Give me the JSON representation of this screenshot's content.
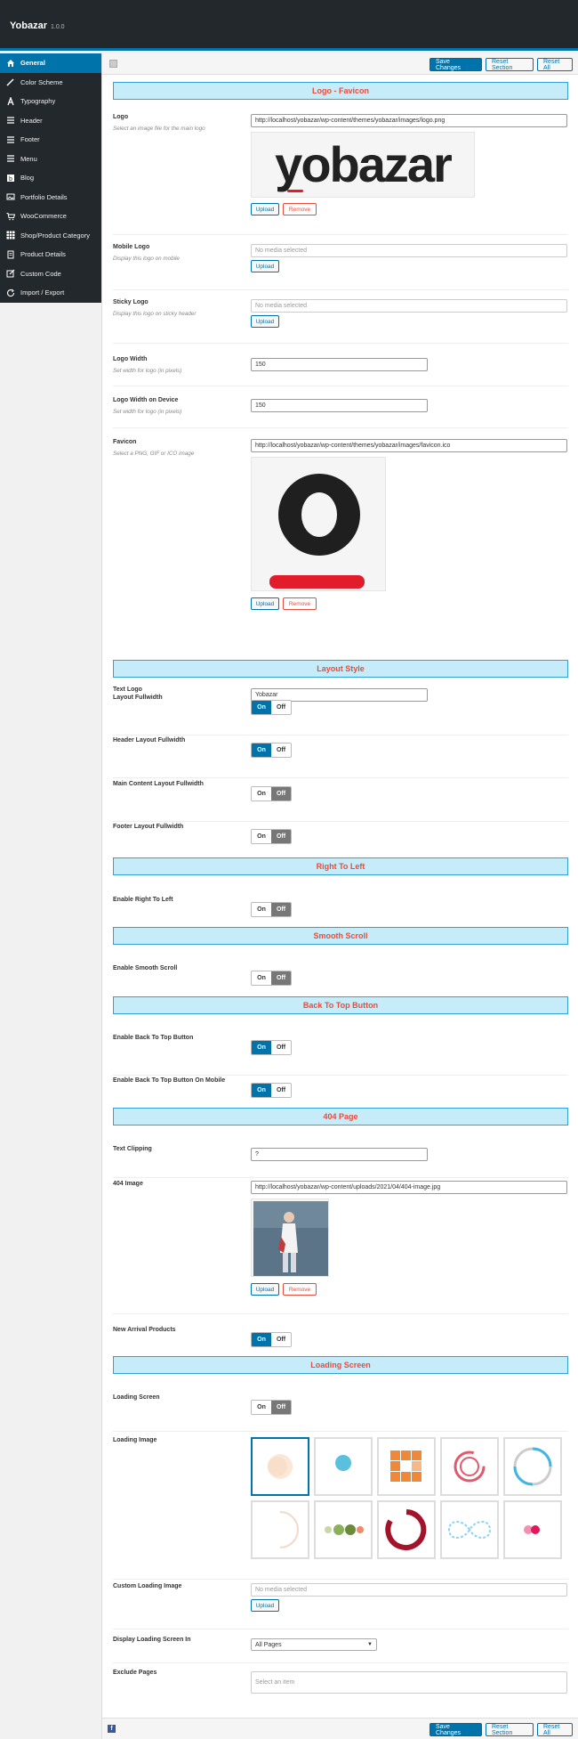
{
  "app": {
    "title": "Yobazar",
    "version": "1.0.0"
  },
  "sidebar": {
    "items": [
      {
        "label": "General",
        "icon": "home-icon",
        "active": true
      },
      {
        "label": "Color Scheme",
        "icon": "brush-icon"
      },
      {
        "label": "Typography",
        "icon": "typography-icon"
      },
      {
        "label": "Header",
        "icon": "menu-lines-icon"
      },
      {
        "label": "Footer",
        "icon": "menu-lines-icon"
      },
      {
        "label": "Menu",
        "icon": "menu-lines-icon"
      },
      {
        "label": "Blog",
        "icon": "blog-icon"
      },
      {
        "label": "Portfolio Details",
        "icon": "image-icon"
      },
      {
        "label": "WooCommerce",
        "icon": "cart-icon"
      },
      {
        "label": "Shop/Product Category",
        "icon": "grid-icon"
      },
      {
        "label": "Product Details",
        "icon": "document-icon"
      },
      {
        "label": "Custom Code",
        "icon": "edit-icon"
      },
      {
        "label": "Import / Export",
        "icon": "refresh-icon"
      }
    ]
  },
  "toolbar": {
    "save": "Save Changes",
    "reset_section": "Reset Section",
    "reset_all": "Reset All"
  },
  "sections": {
    "logo_favicon": "Logo - Favicon",
    "layout_style": "Layout Style",
    "rtl": "Right To Left",
    "smooth_scroll": "Smooth Scroll",
    "back_to_top": "Back To Top Button",
    "page_404": "404 Page",
    "loading_screen": "Loading Screen"
  },
  "buttons": {
    "upload": "Upload",
    "remove": "Remove"
  },
  "toggle": {
    "on": "On",
    "off": "Off"
  },
  "fields": {
    "logo": {
      "label": "Logo",
      "desc": "Select an image file for the main logo",
      "value": "http://localhost/yobazar/wp-content/themes/yobazar/images/logo.png",
      "preview_text": "yobazar"
    },
    "mobile_logo": {
      "label": "Mobile Logo",
      "desc": "Display this logo on mobile",
      "placeholder": "No media selected"
    },
    "sticky_logo": {
      "label": "Sticky Logo",
      "desc": "Display this logo on sticky header",
      "placeholder": "No media selected"
    },
    "logo_width": {
      "label": "Logo Width",
      "desc": "Set width for logo (in pixels)",
      "value": "150"
    },
    "logo_width_device": {
      "label": "Logo Width on Device",
      "desc": "Set width for logo (in pixels)",
      "value": "150"
    },
    "favicon": {
      "label": "Favicon",
      "desc": "Select a PNG, GIF or ICO image",
      "value": "http://localhost/yobazar/wp-content/themes/yobazar/images/favicon.ico"
    },
    "text_logo": {
      "label": "Text Logo",
      "value": "Yobazar"
    },
    "layout_fullwidth": {
      "label": "Layout Fullwidth",
      "state": "on"
    },
    "header_fullwidth": {
      "label": "Header Layout Fullwidth",
      "state": "on"
    },
    "main_fullwidth": {
      "label": "Main Content Layout Fullwidth",
      "state": "off"
    },
    "footer_fullwidth": {
      "label": "Footer Layout Fullwidth",
      "state": "off"
    },
    "enable_rtl": {
      "label": "Enable Right To Left",
      "state": "off"
    },
    "enable_smooth": {
      "label": "Enable Smooth Scroll",
      "state": "off"
    },
    "back_to_top": {
      "label": "Enable Back To Top Button",
      "state": "on"
    },
    "back_to_top_mobile": {
      "label": "Enable Back To Top Button On Mobile",
      "state": "on"
    },
    "text_clipping": {
      "label": "Text Clipping",
      "value": "?"
    },
    "img_404": {
      "label": "404 Image",
      "value": "http://localhost/yobazar/wp-content/uploads/2021/04/404-image.jpg"
    },
    "new_arrival": {
      "label": "New Arrival Products",
      "state": "on"
    },
    "loading_screen": {
      "label": "Loading Screen",
      "state": "off"
    },
    "loading_image": {
      "label": "Loading Image",
      "selected_index": 0
    },
    "custom_loading": {
      "label": "Custom Loading Image",
      "placeholder": "No media selected"
    },
    "display_loading": {
      "label": "Display Loading Screen In",
      "value": "All Pages"
    },
    "exclude_pages": {
      "label": "Exclude Pages",
      "placeholder": "Select an item"
    }
  },
  "colors": {
    "accent": "#0073aa",
    "section_bg": "#c7ecf9",
    "section_text": "#e74c3c",
    "sidebar_bg": "#23282d"
  }
}
